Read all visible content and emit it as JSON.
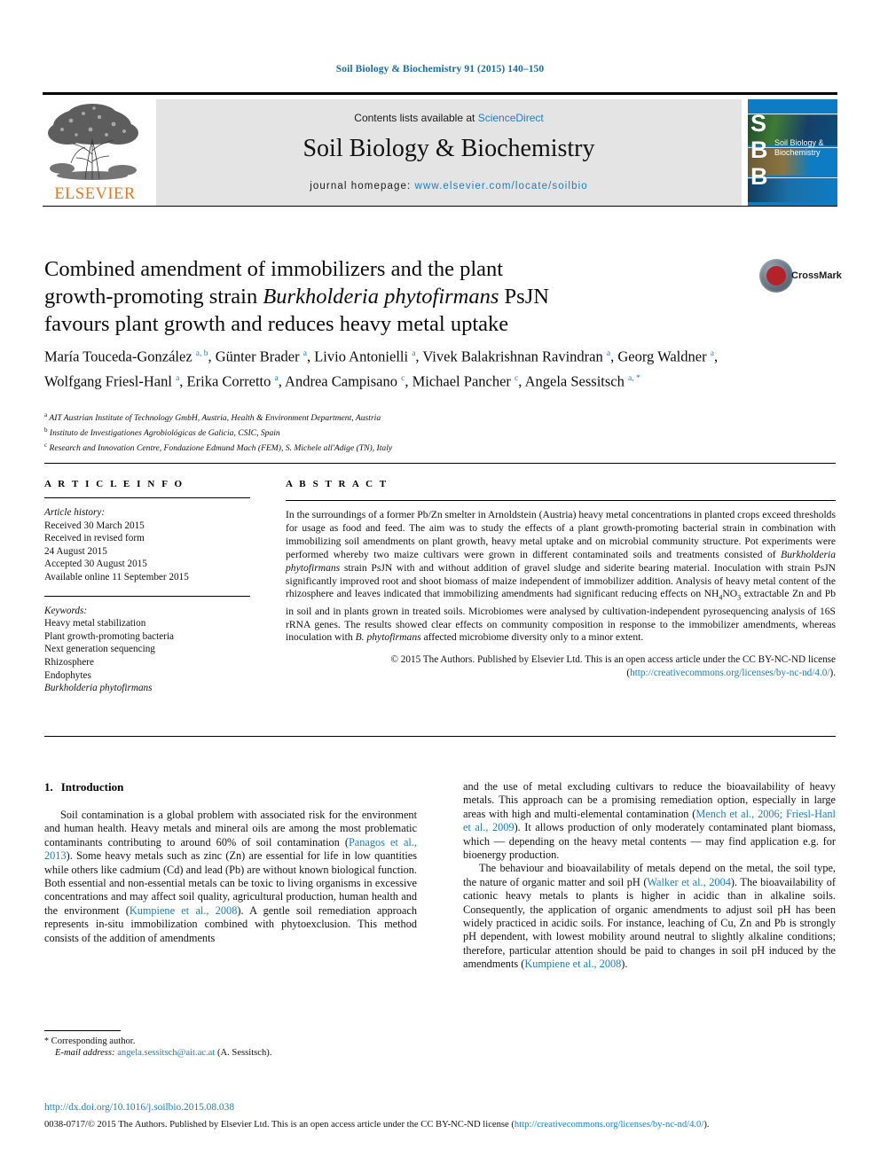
{
  "journal_ref": "Soil Biology & Biochemistry 91 (2015) 140–150",
  "masthead": {
    "contents_prefix": "Contents lists available at ",
    "sciencedirect": "ScienceDirect",
    "journal_title": "Soil Biology & Biochemistry",
    "homepage_label": "journal homepage: ",
    "homepage_url": "www.elsevier.com/locate/soilbio",
    "publisher_wordmark": "ELSEVIER",
    "publisher_color": "#E87722",
    "cover_initials": "S\nB\nB",
    "cover_title": "Soil Biology & Biochemistry",
    "cover_color": "#0d7cc4"
  },
  "crossmark": {
    "label": "CrossMark"
  },
  "article": {
    "title_line1": "Combined amendment of immobilizers and the plant",
    "title_line2_a": "growth-promoting strain ",
    "title_line2_i": "Burkholderia phytofirmans",
    "title_line2_b": " PsJN",
    "title_line3": "favours plant growth and reduces heavy metal uptake",
    "authors_html": "María Touceda-González <sup>a, b</sup>, Günter Brader <sup>a</sup>, Livio Antonielli <sup>a</sup>, Vivek Balakrishnan Ravindran <sup>a</sup>, Georg Waldner <sup>a</sup>, Wolfgang Friesl-Hanl <sup>a</sup>, Erika Corretto <sup>a</sup>, Andrea Campisano <sup>c</sup>, Michael Pancher <sup>c</sup>, Angela Sessitsch <sup>a, *</sup>",
    "affiliations": [
      {
        "mark": "a",
        "text": "AIT Austrian Institute of Technology GmbH, Austria, Health & Environment Department, Austria"
      },
      {
        "mark": "b",
        "text": "Instituto de Investigationes Agrobiológicas de Galicia, CSIC, Spain"
      },
      {
        "mark": "c",
        "text": "Research and Innovation Centre, Fondazione Edmund Mach (FEM), S. Michele all'Adige (TN), Italy"
      }
    ]
  },
  "article_info": {
    "heading": "A R T I C L E   I N F O",
    "history_label": "Article history:",
    "history": [
      "Received 30 March 2015",
      "Received in revised form",
      "24 August 2015",
      "Accepted 30 August 2015",
      "Available online 11 September 2015"
    ],
    "keywords_label": "Keywords:",
    "keywords": [
      "Heavy metal stabilization",
      "Plant growth-promoting bacteria",
      "Next generation sequencing",
      "Rhizosphere",
      "Endophytes"
    ],
    "keyword_italic": "Burkholderia phytofirmans"
  },
  "abstract": {
    "heading": "A B S T R A C T",
    "body_html": "In the surroundings of a former Pb/Zn smelter in Arnoldstein (Austria) heavy metal concentrations in planted crops exceed thresholds for usage as food and feed. The aim was to study the effects of a plant growth-promoting bacterial strain in combination with immobilizing soil amendments on plant growth, heavy metal uptake and on microbial community structure. Pot experiments were performed whereby two maize cultivars were grown in different contaminated soils and treatments consisted of <i>Burkholderia phytofirmans</i> strain PsJN with and without addition of gravel sludge and siderite bearing material. Inoculation with strain PsJN significantly improved root and shoot biomass of maize independent of immobilizer addition. Analysis of heavy metal content of the rhizosphere and leaves indicated that immobilizing amendments had significant reducing effects on NH<sub>4</sub>NO<sub>3</sub> extractable Zn and Pb in soil and in plants grown in treated soils. Microbiomes were analysed by cultivation-independent pyrosequencing analysis of 16S rRNA genes. The results showed clear effects on community composition in response to the immobilizer amendments, whereas inoculation with <i>B. phytofirmans</i> affected microbiome diversity only to a minor extent.",
    "copyright_html": "© 2015 The Authors. Published by Elsevier Ltd. This is an open access article under the CC BY-NC-ND license (<span class=\"lnk\">http://creativecommons.org/licenses/by-nc-nd/4.0/</span>)."
  },
  "sections": {
    "intro_number": "1.",
    "intro_title": "Introduction",
    "left_paragraphs_html": [
      "Soil contamination is a global problem with associated risk for the environment and human health. Heavy metals and mineral oils are among the most problematic contaminants contributing to around 60% of soil contamination (<span class=\"cite\">Panagos et al., 2013</span>). Some heavy metals such as zinc (Zn) are essential for life in low quantities while others like cadmium (Cd) and lead (Pb) are without known biological function. Both essential and non-essential metals can be toxic to living organisms in excessive concentrations and may affect soil quality, agricultural production, human health and the environment (<span class=\"cite\">Kumpiene et al., 2008</span>). A gentle soil remediation approach represents in-situ immobilization combined with phytoexclusion. This method consists of the addition of amendments"
    ],
    "right_paragraphs_html": [
      "and the use of metal excluding cultivars to reduce the bioavailability of heavy metals. This approach can be a promising remediation option, especially in large areas with high and multi-elemental contamination (<span class=\"cite\">Mench et al., 2006; Friesl-Hanl et al., 2009</span>). It allows production of only moderately contaminated plant biomass, which — depending on the heavy metal contents — may find application e.g. for bioenergy production.",
      "The behaviour and bioavailability of metals depend on the metal, the soil type, the nature of organic matter and soil pH (<span class=\"cite\">Walker et al., 2004</span>). The bioavailability of cationic heavy metals to plants is higher in acidic than in alkaline soils. Consequently, the application of organic amendments to adjust soil pH has been widely practiced in acidic soils. For instance, leaching of Cu, Zn and Pb is strongly pH dependent, with lowest mobility around neutral to slightly alkaline conditions; therefore, particular attention should be paid to changes in soil pH induced by the amendments (<span class=\"cite\">Kumpiene et al., 2008</span>)."
    ]
  },
  "footnote": {
    "corresponding": "Corresponding author.",
    "email_label": "E-mail address:",
    "email": "angela.sessitsch@ait.ac.at",
    "email_owner": "(A. Sessitsch)."
  },
  "footer": {
    "doi": "http://dx.doi.org/10.1016/j.soilbio.2015.08.038",
    "issn_html": "0038-0717/© 2015 The Authors. Published by Elsevier Ltd. This is an open access article under the CC BY-NC-ND license (<span class=\"lnk\">http://creativecommons.org/licenses/by-nc-nd/4.0/</span>)."
  }
}
